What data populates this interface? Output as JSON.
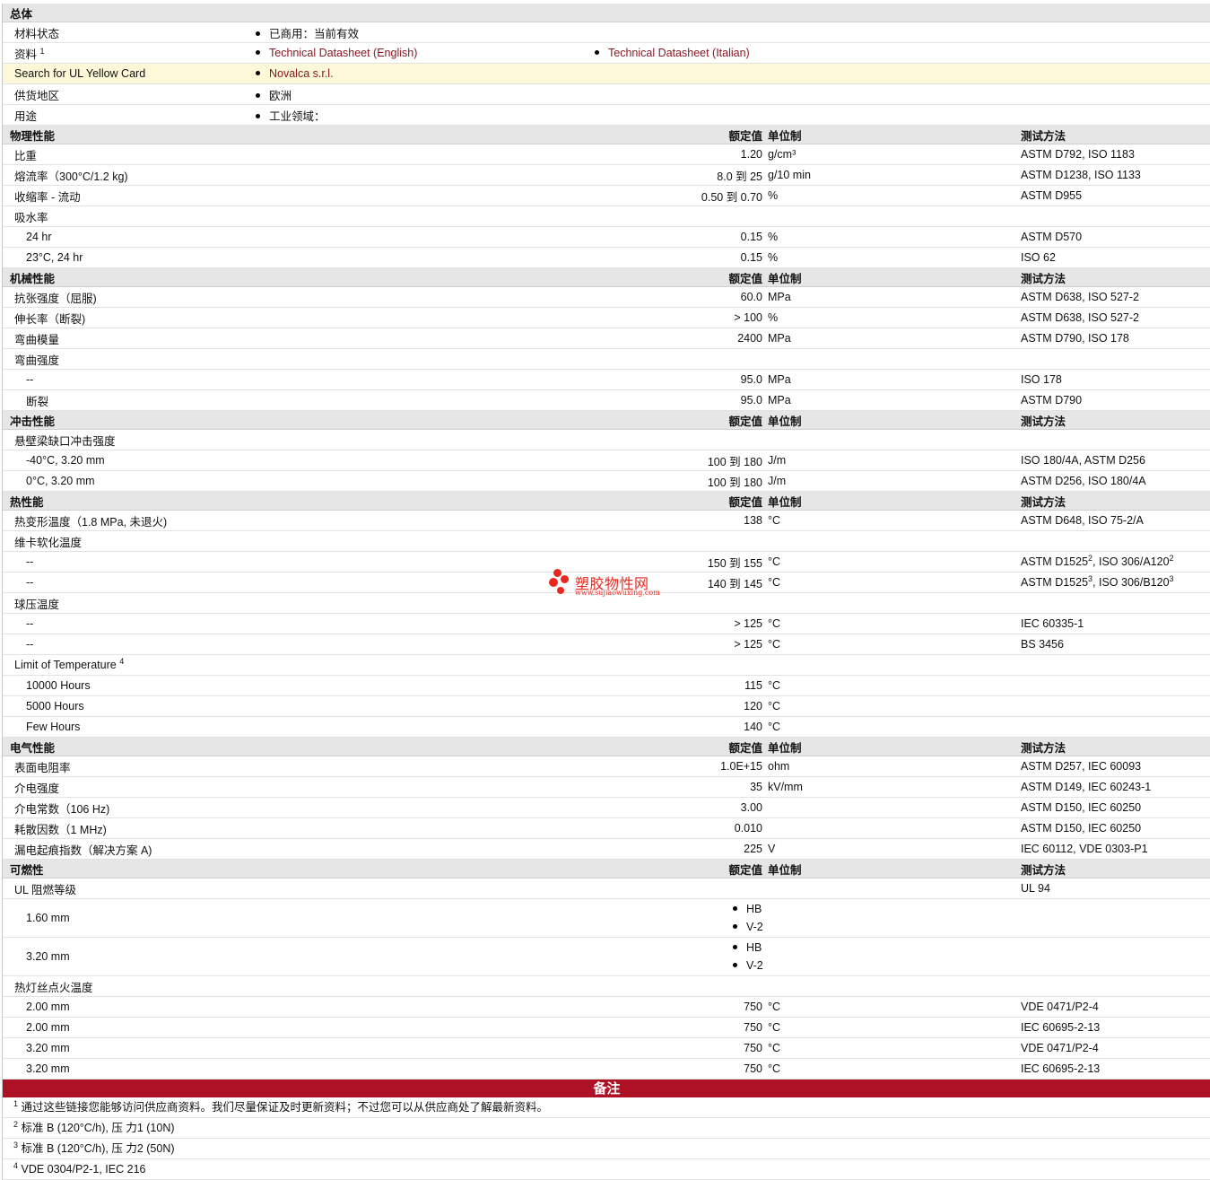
{
  "general": {
    "title": "总体",
    "rows": [
      {
        "label": "材料状态",
        "value": "已商用：当前有效"
      },
      {
        "label": "资料",
        "sup": "1",
        "link1": "Technical Datasheet (English)",
        "link2": "Technical Datasheet (Italian)"
      },
      {
        "label": "Search for UL Yellow Card",
        "link1": "Novalca s.r.l."
      },
      {
        "label": "供货地区",
        "value": "欧洲"
      },
      {
        "label": "用途",
        "value": "工业领域："
      }
    ]
  },
  "headers": {
    "rated": "额定值",
    "unit": "单位制",
    "method": "测试方法"
  },
  "sections": {
    "physical": {
      "title": "物理性能",
      "rows": [
        {
          "label": "比重",
          "value": "1.20",
          "unit": "g/cm³",
          "method": "ASTM D792, ISO 1183"
        },
        {
          "label": "熔流率（300°C/1.2 kg)",
          "value": "8.0 到  25",
          "unit": "g/10 min",
          "method": "ASTM D1238, ISO 1133"
        },
        {
          "label": "收缩率  - 流动",
          "value": "0.50 到  0.70",
          "unit": "%",
          "method": "ASTM D955"
        },
        {
          "label": "吸水率"
        },
        {
          "label": "24 hr",
          "value": "0.15",
          "unit": "%",
          "method": "ASTM D570"
        },
        {
          "label": "23°C, 24 hr",
          "value": "0.15",
          "unit": "%",
          "method": "ISO 62"
        }
      ]
    },
    "mechanical": {
      "title": "机械性能",
      "rows": [
        {
          "label": "抗张强度（屈服)",
          "value": "60.0",
          "unit": "MPa",
          "method": "ASTM D638, ISO 527-2"
        },
        {
          "label": "伸长率（断裂)",
          "value": "> 100",
          "unit": "%",
          "method": "ASTM D638, ISO 527-2"
        },
        {
          "label": "弯曲模量",
          "value": "2400",
          "unit": "MPa",
          "method": "ASTM D790, ISO 178"
        },
        {
          "label": "弯曲强度"
        },
        {
          "label": "--",
          "value": "95.0",
          "unit": "MPa",
          "method": "ISO 178"
        },
        {
          "label": "断裂",
          "value": "95.0",
          "unit": "MPa",
          "method": "ASTM D790"
        }
      ]
    },
    "impact": {
      "title": "冲击性能",
      "rows": [
        {
          "label": "悬壁梁缺口冲击强度"
        },
        {
          "label": "-40°C, 3.20 mm",
          "value": "100 到  180",
          "unit": "J/m",
          "method": "ISO 180/4A, ASTM D256"
        },
        {
          "label": "0°C, 3.20 mm",
          "value": "100 到  180",
          "unit": "J/m",
          "method": "ASTM D256, ISO 180/4A"
        }
      ]
    },
    "thermal": {
      "title": "热性能",
      "rows": [
        {
          "label": "热变形温度（1.8 MPa, 未退火)",
          "value": "138",
          "unit": "°C",
          "method": "ASTM D648, ISO 75-2/A"
        },
        {
          "label": "维卡软化温度"
        },
        {
          "label": "--",
          "value": "150 到  155",
          "unit": "°C",
          "method_a": "ASTM D1525",
          "sup_a": "2",
          "method_b": ", ISO 306/A120",
          "sup_b": "2"
        },
        {
          "label": "--",
          "value": "140 到  145",
          "unit": "°C",
          "method_a": "ASTM D1525",
          "sup_a": "3",
          "method_b": ", ISO 306/B120",
          "sup_b": "3"
        },
        {
          "label": "球压温度"
        },
        {
          "label": "--",
          "value": "> 125",
          "unit": "°C",
          "method": "IEC 60335-1"
        },
        {
          "label": "--",
          "value": "> 125",
          "unit": "°C",
          "method": "BS 3456"
        },
        {
          "label": "Limit of Temperature",
          "sup": "4"
        },
        {
          "label": "10000 Hours",
          "value": "115",
          "unit": "°C"
        },
        {
          "label": "5000 Hours",
          "value": "120",
          "unit": "°C"
        },
        {
          "label": "Few Hours",
          "value": "140",
          "unit": "°C"
        }
      ]
    },
    "electrical": {
      "title": "电气性能",
      "rows": [
        {
          "label": "表面电阻率",
          "value": "1.0E+15",
          "unit": "ohm",
          "method": "ASTM D257, IEC 60093"
        },
        {
          "label": "介电强度",
          "value": "35",
          "unit": "kV/mm",
          "method": "ASTM D149, IEC 60243-1"
        },
        {
          "label": "介电常数（106 Hz)",
          "value": "3.00",
          "unit": "",
          "method": "ASTM D150, IEC 60250"
        },
        {
          "label": "耗散因数（1 MHz)",
          "value": "0.010",
          "unit": "",
          "method": "ASTM D150, IEC 60250"
        },
        {
          "label": "漏电起痕指数（解决方案  A)",
          "value": "225",
          "unit": "V",
          "method": "IEC 60112, VDE 0303-P1"
        }
      ]
    },
    "flammability": {
      "title": "可燃性",
      "ul_label": "UL 阻燃等级",
      "ul_method": "UL 94",
      "ul_rows": [
        {
          "label": "1.60 mm",
          "items": [
            "HB",
            "V-2"
          ]
        },
        {
          "label": "3.20 mm",
          "items": [
            "HB",
            "V-2"
          ]
        }
      ],
      "gwit_label": "热灯丝点火温度",
      "rows": [
        {
          "label": "2.00 mm",
          "value": "750",
          "unit": "°C",
          "method": "VDE 0471/P2-4"
        },
        {
          "label": "2.00 mm",
          "value": "750",
          "unit": "°C",
          "method": "IEC 60695-2-13"
        },
        {
          "label": "3.20 mm",
          "value": "750",
          "unit": "°C",
          "method": "VDE 0471/P2-4"
        },
        {
          "label": "3.20 mm",
          "value": "750",
          "unit": "°C",
          "method": "IEC 60695-2-13"
        }
      ]
    }
  },
  "notes": {
    "title": "备注",
    "items": [
      {
        "num": "1",
        "text": "通过这些链接您能够访问供应商资料。我们尽量保证及时更新资料；不过您可以从供应商处了解最新资料。"
      },
      {
        "num": "2",
        "text": "标准  B (120°C/h), 压  力1 (10N)"
      },
      {
        "num": "3",
        "text": "标准  B (120°C/h), 压  力2 (50N)"
      },
      {
        "num": "4",
        "text": "VDE 0304/P2-1, IEC 216"
      }
    ]
  },
  "watermark": {
    "name": "塑胶物性网",
    "url": "www.sujiaowuxing.com",
    "color": "#e8281e"
  },
  "colors": {
    "section_bg": "#e6e6e6",
    "highlight_bg": "#fcf8d8",
    "link": "#8a1722",
    "banner": "#ae1125"
  }
}
